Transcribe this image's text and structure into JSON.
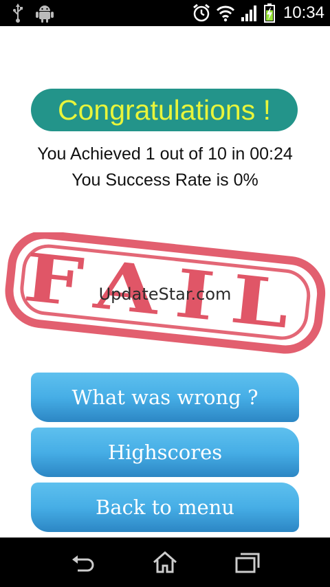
{
  "status_bar": {
    "time": "10:34",
    "left_icons": [
      "usb-icon",
      "android-icon"
    ],
    "right_icons": [
      "alarm-icon",
      "wifi-icon",
      "signal-icon",
      "battery-charging-icon"
    ]
  },
  "result": {
    "title": "Congratulations !",
    "achieved_line": "You Achieved 1 out of 10 in 00:24",
    "success_line": "You Success Rate is 0%",
    "stamp_text": "FAIL"
  },
  "watermark": "UpdateStar.com",
  "buttons": {
    "what_was_wrong": "What was wrong ?",
    "highscores": "Highscores",
    "back_to_menu": "Back to menu"
  },
  "nav_bar": [
    "back-icon",
    "home-icon",
    "recent-apps-icon"
  ],
  "colors": {
    "title_pill": "#23948a",
    "title_text": "#e8f53b",
    "stamp": "#e05667",
    "button_top": "#5ec0ee",
    "button_bottom": "#2c86c4"
  }
}
